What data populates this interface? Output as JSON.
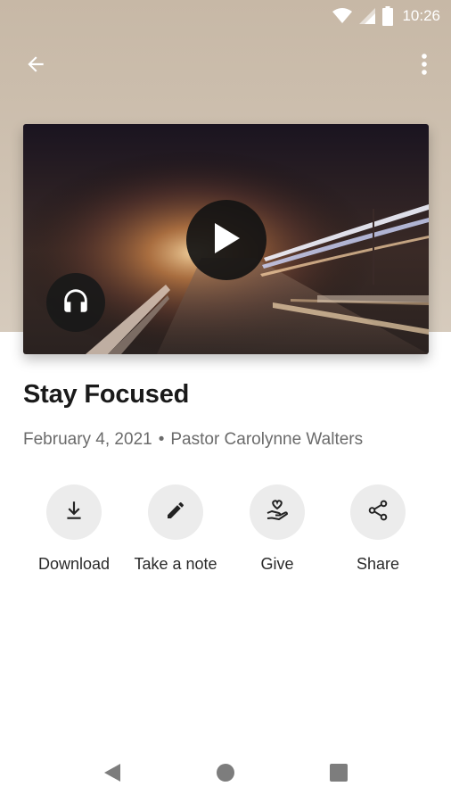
{
  "status_bar": {
    "time": "10:26",
    "icons": [
      "wifi-icon",
      "signal-icon",
      "battery-icon"
    ]
  },
  "app_bar": {
    "back_icon": "arrow-left-icon",
    "menu_icon": "more-vert-icon"
  },
  "media": {
    "play_icon": "play-icon",
    "audio_icon": "headphones-icon"
  },
  "sermon": {
    "title": "Stay Focused",
    "date": "February 4, 2021",
    "separator": "•",
    "speaker": "Pastor Carolynne Walters"
  },
  "actions": [
    {
      "label": "Download",
      "icon": "download-icon"
    },
    {
      "label": "Take a note",
      "icon": "pencil-icon"
    },
    {
      "label": "Give",
      "icon": "give-hand-heart-icon"
    },
    {
      "label": "Share",
      "icon": "share-icon"
    }
  ],
  "nav": {
    "icons": [
      "back-triangle-icon",
      "home-circle-icon",
      "recents-square-icon"
    ]
  },
  "colors": {
    "hero_bg": "#cbbdab",
    "action_circle": "#ececec",
    "meta_text": "#6b6b6b"
  }
}
